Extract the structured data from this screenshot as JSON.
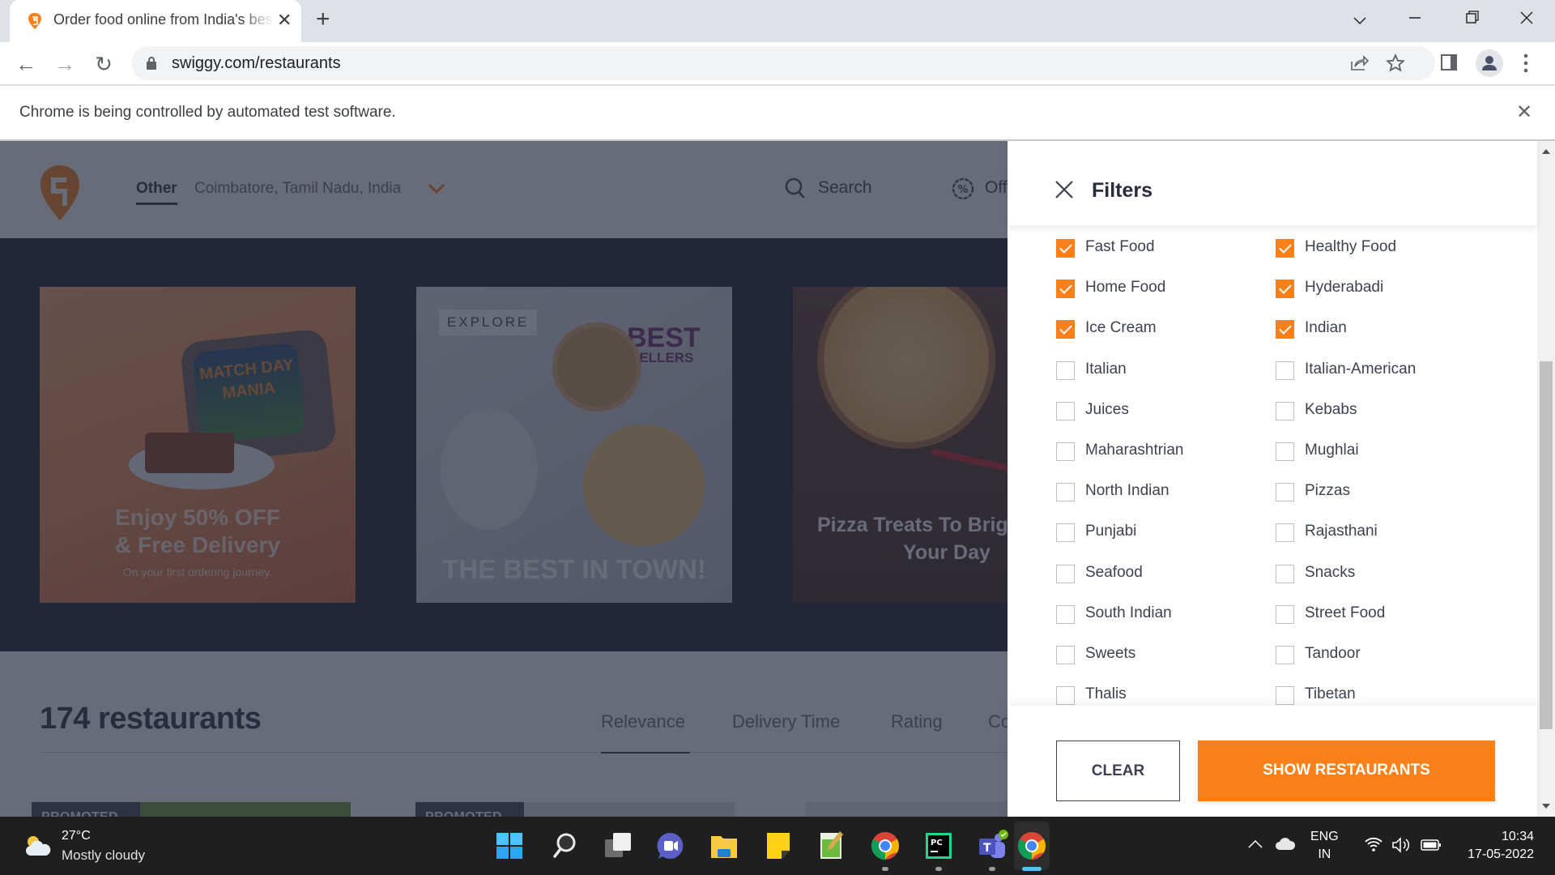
{
  "browser": {
    "tab_title": "Order food online from India's best food delivery service",
    "url": "swiggy.com/restaurants",
    "infobar_message": "Chrome is being controlled by automated test software."
  },
  "site": {
    "location_label": "Other",
    "location_address": "Coimbatore, Tamil Nadu, India",
    "nav": {
      "search": "Search",
      "offers": "Offers"
    },
    "banners": [
      {
        "tv_text": "MATCH DAY MANIA",
        "headline_1": "Enjoy 50% OFF",
        "headline_2": "& Free Delivery",
        "subtext": "On your first ordering journey."
      },
      {
        "tag": "EXPLORE",
        "badge_1": "BEST",
        "badge_2": "SELLERS",
        "headline": "THE BEST IN TOWN!"
      },
      {
        "headline_1": "Pizza Treats To Brighten",
        "headline_2": "Your Day"
      }
    ],
    "restaurant_count": "174 restaurants",
    "sort_options": [
      "Relevance",
      "Delivery Time",
      "Rating",
      "Cost: Low To High"
    ],
    "sort_selected": "Relevance",
    "promoted_label": "PROMOTED"
  },
  "filters": {
    "title": "Filters",
    "options": [
      {
        "label": "Fast Food",
        "checked": true
      },
      {
        "label": "Healthy Food",
        "checked": true
      },
      {
        "label": "Home Food",
        "checked": true
      },
      {
        "label": "Hyderabadi",
        "checked": true
      },
      {
        "label": "Ice Cream",
        "checked": true
      },
      {
        "label": "Indian",
        "checked": true
      },
      {
        "label": "Italian",
        "checked": false
      },
      {
        "label": "Italian-American",
        "checked": false
      },
      {
        "label": "Juices",
        "checked": false
      },
      {
        "label": "Kebabs",
        "checked": false
      },
      {
        "label": "Maharashtrian",
        "checked": false
      },
      {
        "label": "Mughlai",
        "checked": false
      },
      {
        "label": "North Indian",
        "checked": false
      },
      {
        "label": "Pizzas",
        "checked": false
      },
      {
        "label": "Punjabi",
        "checked": false
      },
      {
        "label": "Rajasthani",
        "checked": false
      },
      {
        "label": "Seafood",
        "checked": false
      },
      {
        "label": "Snacks",
        "checked": false
      },
      {
        "label": "South Indian",
        "checked": false
      },
      {
        "label": "Street Food",
        "checked": false
      },
      {
        "label": "Sweets",
        "checked": false
      },
      {
        "label": "Tandoor",
        "checked": false
      },
      {
        "label": "Thalis",
        "checked": false
      },
      {
        "label": "Tibetan",
        "checked": false
      }
    ],
    "clear_label": "CLEAR",
    "show_label": "SHOW RESTAURANTS"
  },
  "colors": {
    "accent": "#fc8019",
    "text_dark": "#282c3f"
  },
  "taskbar": {
    "weather_temp": "27°C",
    "weather_desc": "Mostly cloudy",
    "apps": [
      "start",
      "search",
      "task-view",
      "chat",
      "file-explorer",
      "sticky-notes",
      "notepad-plus-plus",
      "chrome",
      "pycharm",
      "teams",
      "chrome-active"
    ],
    "lang_1": "ENG",
    "lang_2": "IN",
    "time": "10:34",
    "date": "17-05-2022"
  }
}
